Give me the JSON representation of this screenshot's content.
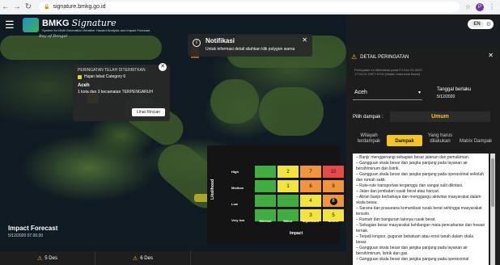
{
  "browser": {
    "url": "signature.bmkg.go.id"
  },
  "header": {
    "logo_title_1": "BMKG",
    "logo_title_2": "Signature",
    "logo_subtitle": "System for Multi Generation Weather Hazard Analysis and Impact Forecast",
    "lang": "EN"
  },
  "map_labels": {
    "bay": "Bay of Bengal"
  },
  "notification": {
    "title": "Notifikasi",
    "text": "Untuk informasi detail silahkan klik polygon warna"
  },
  "popup": {
    "heading": "PERINGATAN TELAH DITERBITKAN",
    "category": "Hujan lebat Category 6",
    "location": "Aceh",
    "count_text": "1 kota dan  3 kecamatan  TERPENGARUH",
    "button": "Lihat Rincian"
  },
  "matrix": {
    "y_label": "Likelihood",
    "x_label": "Impact",
    "rows": [
      "High",
      "Medium",
      "Low",
      "Very low"
    ],
    "cols": [
      "Minimal",
      "Minor",
      "Significant",
      "Severe"
    ],
    "cells": [
      [
        "",
        "2",
        "7",
        "10"
      ],
      [
        "",
        "1",
        "6",
        "9"
      ],
      [
        "",
        "",
        "4",
        "8"
      ],
      [
        "",
        "",
        "3",
        "5"
      ]
    ],
    "selected": "8",
    "colors": {
      "green": "#3fae3f",
      "yellow": "#f3e43a",
      "orange": "#f0953a",
      "red": "#e84a4a"
    }
  },
  "impact_forecast": {
    "title": "Impact Forecast",
    "date": "5/12/2020 07.00.00"
  },
  "date_tabs": [
    "5 Des",
    "6 Des"
  ],
  "panel": {
    "title": "DETAIL PERINGATAN",
    "issued": "Peringatan ini diterbitkan pada Fri Dec 04 2020\n17:04:21 GMT+0700 (Waktu Indonesia Barat)",
    "region": "Aceh",
    "valid_label": "Tanggal berlaku",
    "valid_value": "5/12/2020",
    "impact_label": "Pilih dampak :",
    "impact_value": "Umum",
    "tabs": [
      "Wilayah terdampak",
      "Dampak",
      "Yang harus dilakukan",
      "Matrix Dampak"
    ],
    "active_tab": "Dampak",
    "impacts": [
      "– Banjir menggenangi sebagian besar jalanan dan pemukiman.",
      "– Gangguan skala besar dan jangka panjang pada layanan air bersih/minum dan listrik.",
      "– Gangguan skala besar dan jangka panjang pada operasional sekolah dan rumah sakit.",
      "– Rute-rute transportasi terganggu dan sangat sulit dilintasi.",
      "– Jalan dan jembatan rusak berat atau hanyut.",
      "– Aliran banjir berbahaya dan menggangu aktivitas masyarakat dalam skala besar.",
      "– Sarana dan prasarana komunikasi rusak berat sehingga masyarakat terisolir.",
      "– Rumah dan bangunan lainnya rusak berat.",
      "– Sebagian besar masyarakat kehilangan mata pencaharian dan hewan ternak.",
      "– Terjadi longsor, guguran bebatuan atau erosi tanah dalam skala besar.",
      "– Gangguan skala besar dan jangka panjang pada layanan air bersih/minum, listrik dan gas.",
      "– Gangguan skala besar dan jangka panjang pada operasional"
    ]
  }
}
